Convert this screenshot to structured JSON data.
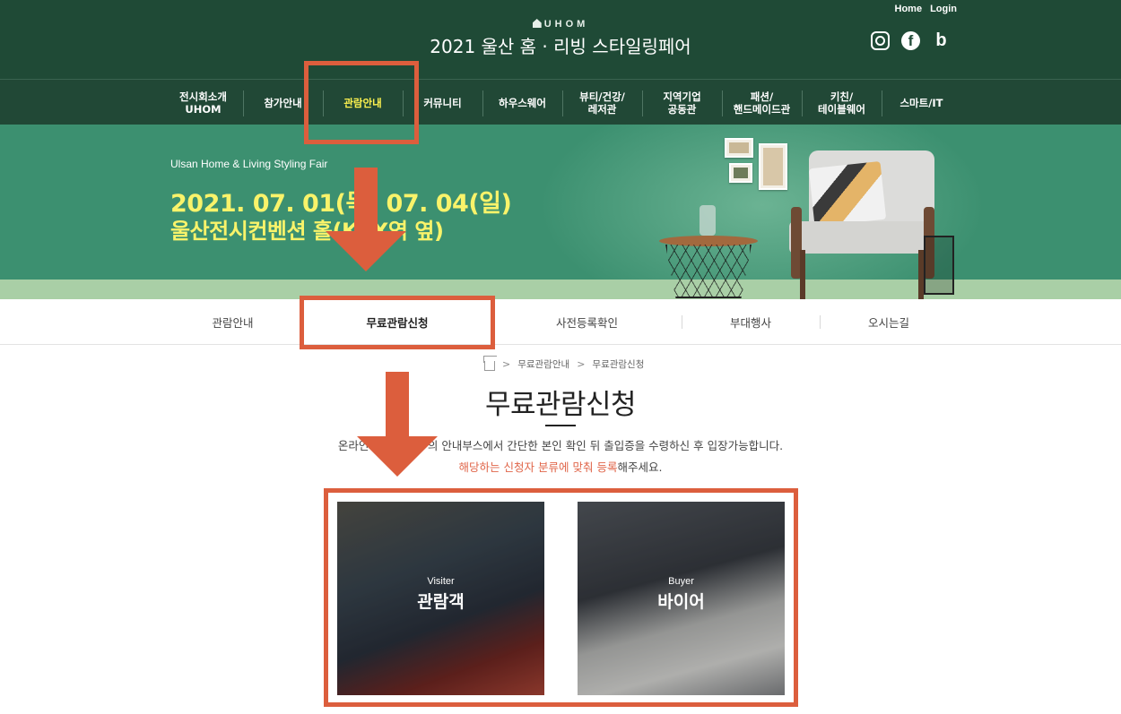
{
  "top_links": {
    "home": "Home",
    "login": "Login"
  },
  "logo": {
    "text": "UHOM"
  },
  "site_title": "2021 울산 홈 · 리빙 스타일링페어",
  "sns": {
    "facebook_glyph": "f",
    "blog_glyph": "b"
  },
  "nav": {
    "items": [
      {
        "label": "전시회소개\nUHOM"
      },
      {
        "label": "참가안내"
      },
      {
        "label": "관람안내"
      },
      {
        "label": "커뮤니티"
      },
      {
        "label": "하우스웨어"
      },
      {
        "label": "뷰티/건강/\n레저관"
      },
      {
        "label": "지역기업\n공동관"
      },
      {
        "label": "패션/\n핸드메이드관"
      },
      {
        "label": "키친/\n테이블웨어"
      },
      {
        "label": "스마트/IT"
      }
    ],
    "active_index": 2
  },
  "banner": {
    "subtitle": "Ulsan Home & Living Styling Fair",
    "date": "2021. 07. 01(목)  07. 04(일)",
    "venue": "울산전시컨벤션     홀(KTX역 옆)"
  },
  "subtabs": {
    "items": [
      {
        "label": "관람안내"
      },
      {
        "label": "무료관람신청"
      },
      {
        "label": "사전등록확인"
      },
      {
        "label": "부대행사"
      },
      {
        "label": "오시는길"
      }
    ],
    "active_index": 1
  },
  "breadcrumb": {
    "separator": ">",
    "items": [
      "무료관람안내",
      "무료관람신청"
    ]
  },
  "page_title": "무료관람신청",
  "description": {
    "line1": "온라인 사전등                 입구의 안내부스에서 간단한 본인 확인 뒤 출입증을 수령하신 후 입장가능합니다.",
    "line2_highlight": "해당하는 신청자 분류에 맞춰 등록",
    "line2_rest": "해주세요."
  },
  "cards": [
    {
      "en": "Visiter",
      "ko": "관람객"
    },
    {
      "en": "Buyer",
      "ko": "바이어"
    }
  ],
  "colors": {
    "header_bg": "#1f4a36",
    "banner_bg": "#3c9070",
    "banner_text": "#f9f36a",
    "nav_active": "#fff34f",
    "annotation": "#dc5e3d",
    "highlight_text": "#e0664a"
  }
}
